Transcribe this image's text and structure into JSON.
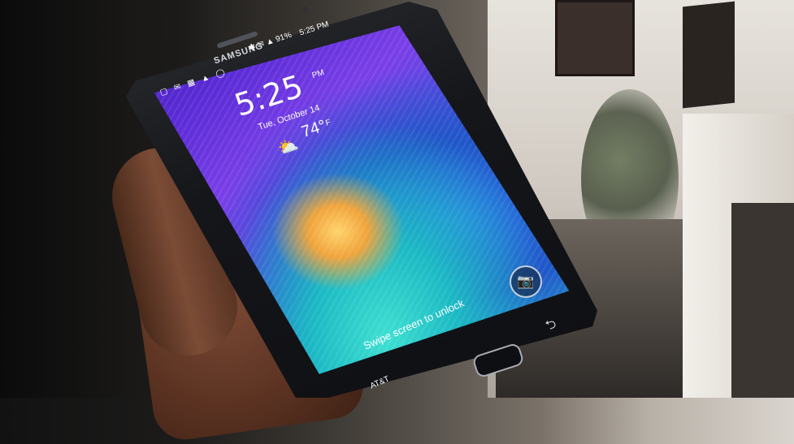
{
  "phone": {
    "brand": "SAMSUNG",
    "status_bar": {
      "left_icons": "▢ ✉ ▦ ▲ ◯",
      "right_icons": "✱ ✉ ▲ 91%",
      "time": "5:25 PM"
    },
    "lockscreen": {
      "time": "5:25",
      "ampm": "PM",
      "date": "Tue, October 14",
      "temperature": "74°",
      "unit": "F",
      "weather_icon": "partly-cloudy-icon",
      "unlock_hint": "Swipe screen to unlock",
      "carrier": "AT&T",
      "camera_icon": "camera-icon"
    },
    "buttons": {
      "back_icon": "back-arrow-icon",
      "home_button": "home-button"
    }
  }
}
